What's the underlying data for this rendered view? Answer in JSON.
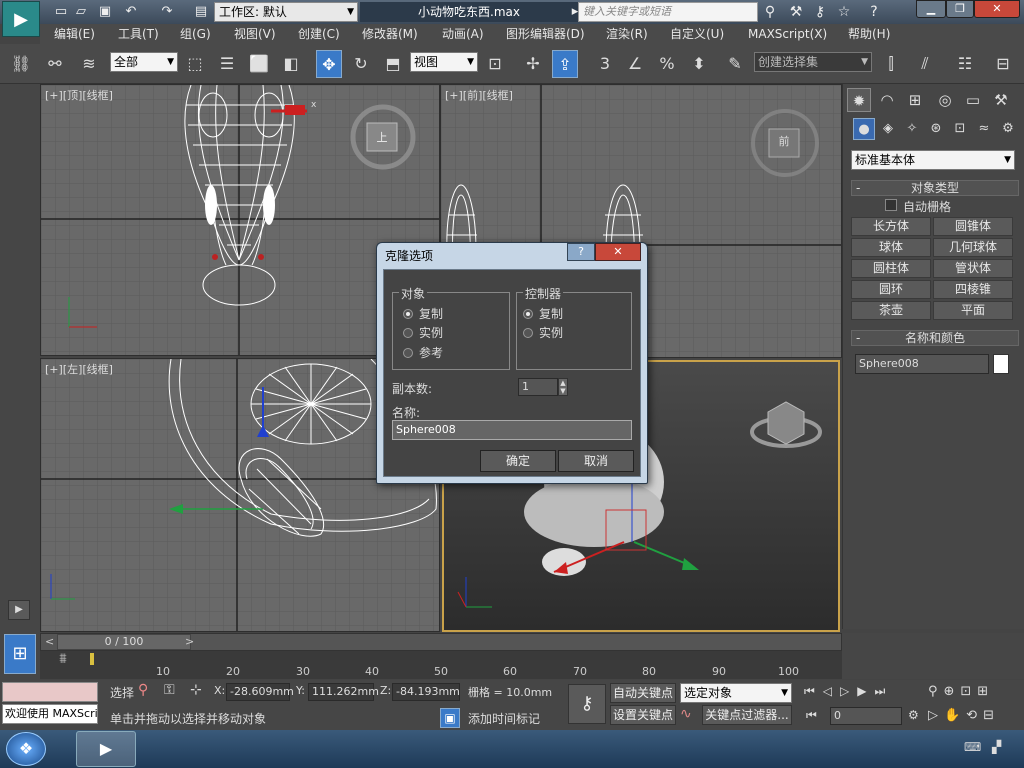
{
  "titlebar": {
    "workspace": "工作区: 默认",
    "document_title": "小动物吃东西.max",
    "search_placeholder": "键入关键字或短语"
  },
  "menu": [
    "编辑(E)",
    "工具(T)",
    "组(G)",
    "视图(V)",
    "创建(C)",
    "修改器(M)",
    "动画(A)",
    "图形编辑器(D)",
    "渲染(R)",
    "自定义(U)",
    "MAXScript(X)",
    "帮助(H)"
  ],
  "toolbar": {
    "filter_dropdown": "全部",
    "coord_dropdown": "视图",
    "selection_set": "创建选择集",
    "spinner_snap_label": "3"
  },
  "viewports": {
    "top": "[+][顶][线框]",
    "front": "[+][前][线框]",
    "left": "[+][左][线框]",
    "top_cube_label": "上",
    "front_cube_label": "前"
  },
  "panel": {
    "category": "标准基本体",
    "object_type_header": "对象类型",
    "autogrid_label": "自动栅格",
    "buttons": [
      "长方体",
      "圆锥体",
      "球体",
      "几何球体",
      "圆柱体",
      "管状体",
      "圆环",
      "四棱锥",
      "茶壶",
      "平面"
    ],
    "name_color_header": "名称和颜色",
    "object_name": "Sphere008",
    "object_color": "#ffffff"
  },
  "dialog": {
    "title": "克隆选项",
    "object_group": "对象",
    "object_options": [
      "复制",
      "实例",
      "参考"
    ],
    "object_selected": 0,
    "controller_group": "控制器",
    "controller_options": [
      "复制",
      "实例"
    ],
    "controller_selected": 0,
    "copies_label": "副本数:",
    "copies_value": "1",
    "name_label": "名称:",
    "name_value": "Sphere008",
    "ok": "确定",
    "cancel": "取消"
  },
  "timeline": {
    "frame_readout": "0 / 100",
    "ticks": [
      "10",
      "20",
      "30",
      "40",
      "50",
      "60",
      "70",
      "80",
      "90",
      "100"
    ]
  },
  "status": {
    "maxscript_prompt": "欢迎使用 MAXScri",
    "select_label": "选择",
    "x_label": "X:",
    "x_value": "-28.609mm",
    "y_label": "Y:",
    "y_value": "111.262mm",
    "z_label": "Z:",
    "z_value": "-84.193mm",
    "grid": "栅格 = 10.0mm",
    "hint": "单击并拖动以选择并移动对象",
    "add_time_tag": "添加时间标记",
    "auto_key": "自动关键点",
    "set_key": "设置关键点",
    "key_mode": "选定对象",
    "key_filters": "关键点过滤器...",
    "frame_value": "0"
  },
  "colors": {
    "accent_blue": "#3a7ac8",
    "viewport_active_border": "#c9a24a",
    "gizmo_red": "#cc2020",
    "gizmo_green": "#20a040",
    "gizmo_blue": "#2040d0"
  }
}
